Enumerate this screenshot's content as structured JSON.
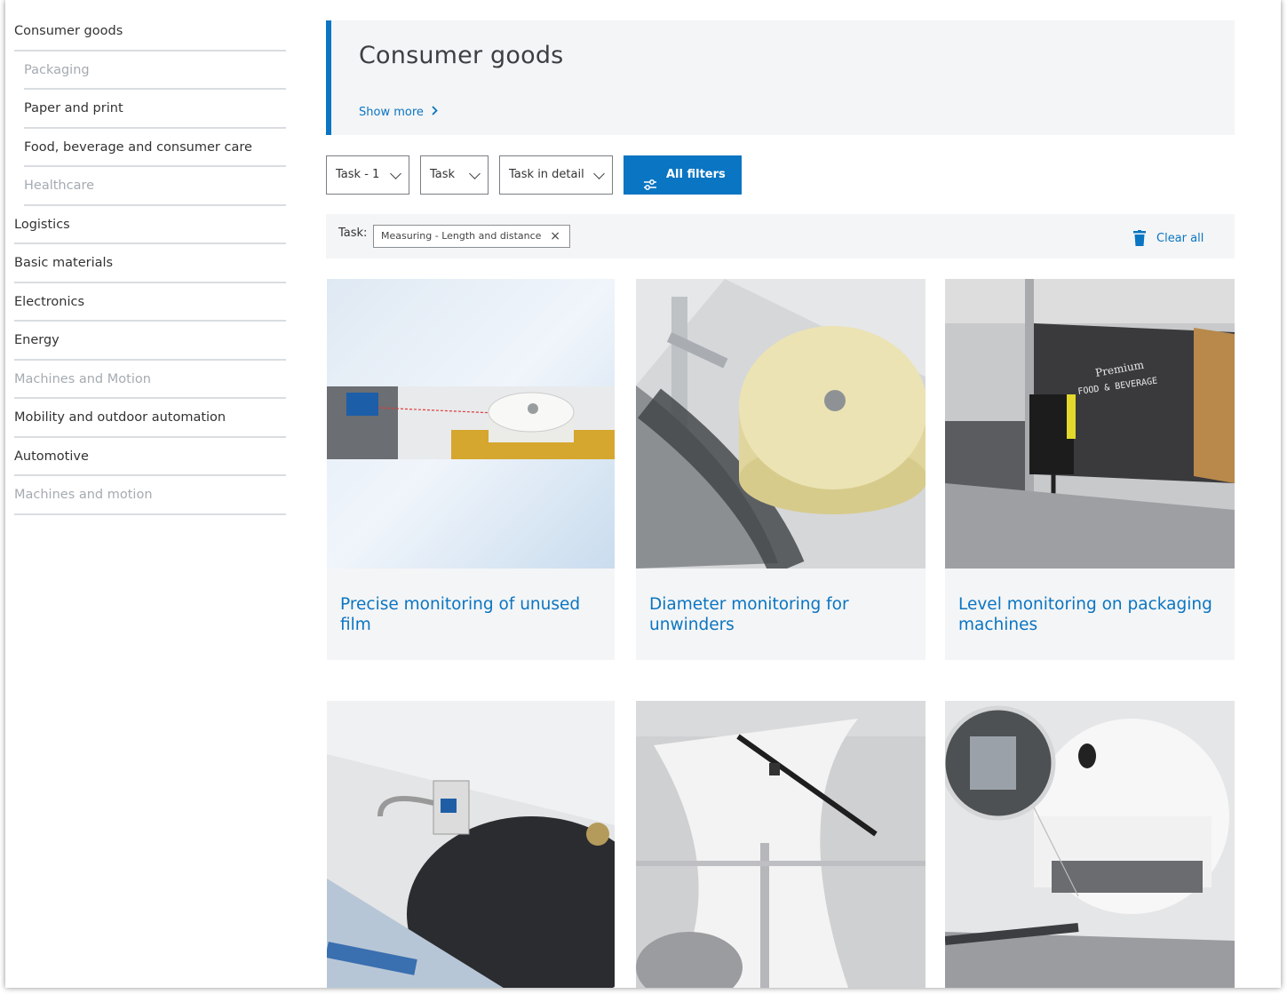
{
  "sidebar": {
    "items": [
      {
        "label": "Consumer goods"
      },
      {
        "label": "Packaging"
      },
      {
        "label": "Paper and print"
      },
      {
        "label": "Food, beverage and consumer care"
      },
      {
        "label": "Healthcare"
      },
      {
        "label": "Logistics"
      },
      {
        "label": "Basic materials"
      },
      {
        "label": "Electronics"
      },
      {
        "label": "Energy"
      },
      {
        "label": "Machines and Motion"
      },
      {
        "label": "Mobility and outdoor automation"
      },
      {
        "label": "Automotive"
      },
      {
        "label": "Machines and motion"
      }
    ]
  },
  "hero": {
    "title": "Consumer goods",
    "show_more": "Show more"
  },
  "filters": {
    "dropdowns": [
      {
        "label": "Task - 1"
      },
      {
        "label": "Task"
      },
      {
        "label": "Task in detail"
      }
    ],
    "all_filters": "All filters"
  },
  "active_filters": {
    "label": "Task:",
    "chips": [
      {
        "label": "Measuring - Length and distance",
        "remove": "×"
      }
    ],
    "clear_all": "Clear all"
  },
  "cards": [
    {
      "title": "Precise monitoring of unused film"
    },
    {
      "title": "Diameter monitoring for unwinders"
    },
    {
      "title": "Level monitoring on packaging machines"
    },
    {
      "title": ""
    },
    {
      "title": ""
    },
    {
      "title": ""
    }
  ],
  "colors": {
    "accent": "#0a75c2",
    "panel": "#f4f5f6",
    "divider": "#d9dde1",
    "muted_text": "#a5abb1"
  },
  "icons": {
    "filter_button": "sliders-icon",
    "dropdown": "chevron-down-icon",
    "chip_remove": "close-icon",
    "clear_all": "trash-icon",
    "show_more": "chevron-right-icon"
  }
}
